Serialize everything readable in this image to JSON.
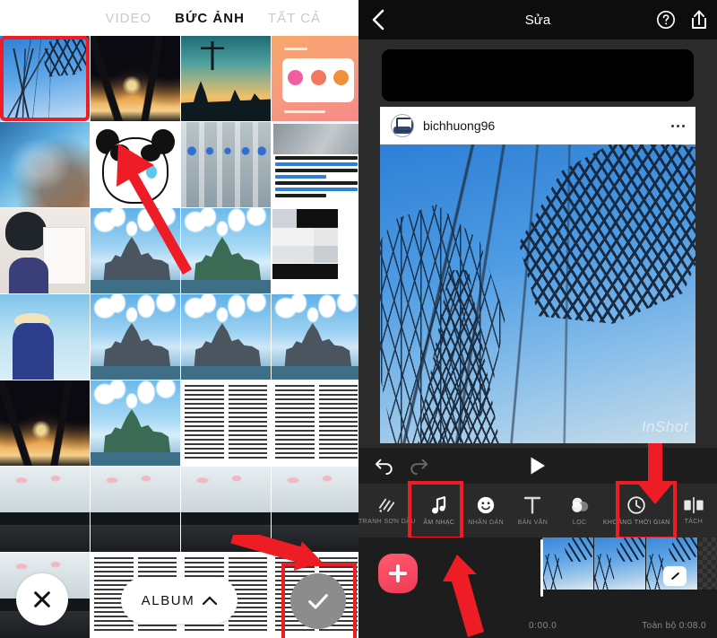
{
  "left_panel": {
    "tabs": [
      {
        "label": "VIDEO",
        "active": false
      },
      {
        "label": "BỨC ẢNH",
        "active": true
      },
      {
        "label": "TẤT CẢ",
        "active": false
      }
    ],
    "grid_cells": [
      {
        "name": "sky-tree-power-lines",
        "selected": true
      },
      {
        "name": "sunset-palms",
        "selected": false
      },
      {
        "name": "church-dusk-silhouette",
        "selected": false
      },
      {
        "name": "orange-tips-card",
        "selected": false
      },
      {
        "name": "blue-cat-portrait",
        "selected": false
      },
      {
        "name": "crying-panda-meme",
        "selected": false
      },
      {
        "name": "robot-figures-row",
        "selected": false
      },
      {
        "name": "ant-financial-article",
        "selected": false
      },
      {
        "name": "girl-with-sketch",
        "selected": false
      },
      {
        "name": "mont-saint-michel-a",
        "selected": false
      },
      {
        "name": "mont-saint-michel-b",
        "selected": false
      },
      {
        "name": "screenshot-collage-a",
        "selected": false
      },
      {
        "name": "picnic-poster",
        "selected": false
      },
      {
        "name": "mont-saint-michel-c",
        "selected": false
      },
      {
        "name": "mont-saint-michel-d",
        "selected": false
      },
      {
        "name": "mont-saint-michel-e",
        "selected": false
      },
      {
        "name": "sunset-palms-b",
        "selected": false
      },
      {
        "name": "mont-saint-michel-f",
        "selected": false
      },
      {
        "name": "document-text-page",
        "selected": false
      },
      {
        "name": "chat-screenshot",
        "selected": false
      },
      {
        "name": "dashcam-flowers-a",
        "selected": false
      },
      {
        "name": "dashcam-flowers-b",
        "selected": false
      },
      {
        "name": "dashcam-flowers-c",
        "selected": false
      },
      {
        "name": "dashcam-flowers-d",
        "selected": false
      },
      {
        "name": "dashcam-dark",
        "selected": false
      },
      {
        "name": "document-text-page-b",
        "selected": false
      },
      {
        "name": "document-text-page-c",
        "selected": false
      },
      {
        "name": "document-text-page-d",
        "selected": false
      }
    ],
    "bottom_bar": {
      "close_icon": "close-icon",
      "album_label": "ALBUM",
      "album_chevron": "chevron-up-icon",
      "confirm_icon": "check-icon"
    }
  },
  "right_panel": {
    "header": {
      "back_icon": "chevron-left-icon",
      "title": "Sửa",
      "help_icon": "question-circle-icon",
      "share_icon": "share-up-icon"
    },
    "preview": {
      "post_username": "bichhuong96",
      "more_icon": "ellipsis-icon",
      "watermark": "InShot"
    },
    "controls": {
      "undo_icon": "undo-icon",
      "redo_icon": "redo-icon",
      "play_icon": "play-icon"
    },
    "toolbar": [
      {
        "label": "TRANH SƠN DẦU",
        "icon": "canvas-stripes-icon",
        "highlighted": false
      },
      {
        "label": "ÂM NHẠC",
        "icon": "music-note-icon",
        "highlighted": true
      },
      {
        "label": "NHÃN DÁN",
        "icon": "smiley-sticker-icon",
        "highlighted": false
      },
      {
        "label": "BẢN VĂN",
        "icon": "text-t-icon",
        "highlighted": false
      },
      {
        "label": "LỌC",
        "icon": "filter-circles-icon",
        "highlighted": false
      },
      {
        "label": "KHOẢNG THỜI GIAN",
        "icon": "clock-icon",
        "highlighted": true
      },
      {
        "label": "TÁCH",
        "icon": "split-icon",
        "highlighted": false
      }
    ],
    "timeline": {
      "add_icon": "plus-icon",
      "transition_icon": "transition-slash-icon",
      "current_time": "0:00.0",
      "total_time": "Toàn bộ 0:08.0"
    }
  },
  "annotations": {
    "accent_color": "#ee1c25",
    "arrows": [
      {
        "name": "arrow-to-selected-photo"
      },
      {
        "name": "arrow-to-confirm-check"
      },
      {
        "name": "arrow-to-duration-tool"
      },
      {
        "name": "arrow-to-music-tool"
      }
    ]
  }
}
